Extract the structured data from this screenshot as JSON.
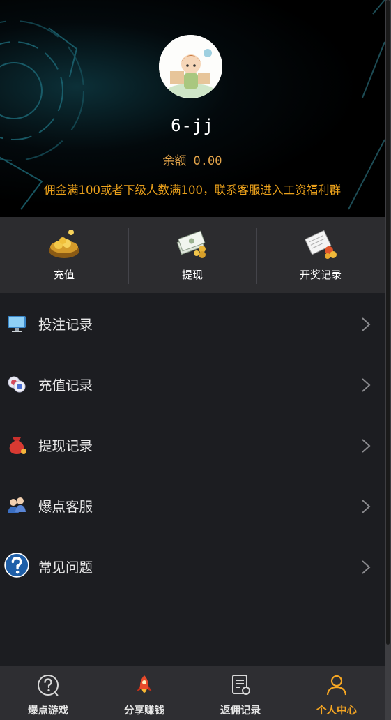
{
  "profile": {
    "username": "6-jj",
    "balance_label": "余额",
    "balance_value": "0.00",
    "notice": "佣金满100或者下级人数满100，联系客服进入工资福利群"
  },
  "quick_actions": [
    {
      "label": "充值",
      "icon": "money-pot-icon"
    },
    {
      "label": "提现",
      "icon": "cash-coins-icon"
    },
    {
      "label": "开奖记录",
      "icon": "lottery-record-icon"
    }
  ],
  "menu": [
    {
      "label": "投注记录",
      "icon": "monitor-icon"
    },
    {
      "label": "充值记录",
      "icon": "chips-icon"
    },
    {
      "label": "提现记录",
      "icon": "money-bag-icon"
    },
    {
      "label": "爆点客服",
      "icon": "customer-service-icon"
    },
    {
      "label": "常见问题",
      "icon": "question-icon"
    }
  ],
  "tabbar": [
    {
      "label": "爆点游戏",
      "icon": "question-circle-icon",
      "active": false
    },
    {
      "label": "分享赚钱",
      "icon": "rocket-icon",
      "active": false
    },
    {
      "label": "返佣记录",
      "icon": "document-icon",
      "active": false
    },
    {
      "label": "个人中心",
      "icon": "person-icon",
      "active": true
    }
  ],
  "colors": {
    "accent": "#f5a623",
    "balance": "#e3a44a",
    "notice": "#eba11b",
    "background": "#1c1d21",
    "action_bar": "#2c2c2f",
    "tabbar": "#2e2e32"
  }
}
